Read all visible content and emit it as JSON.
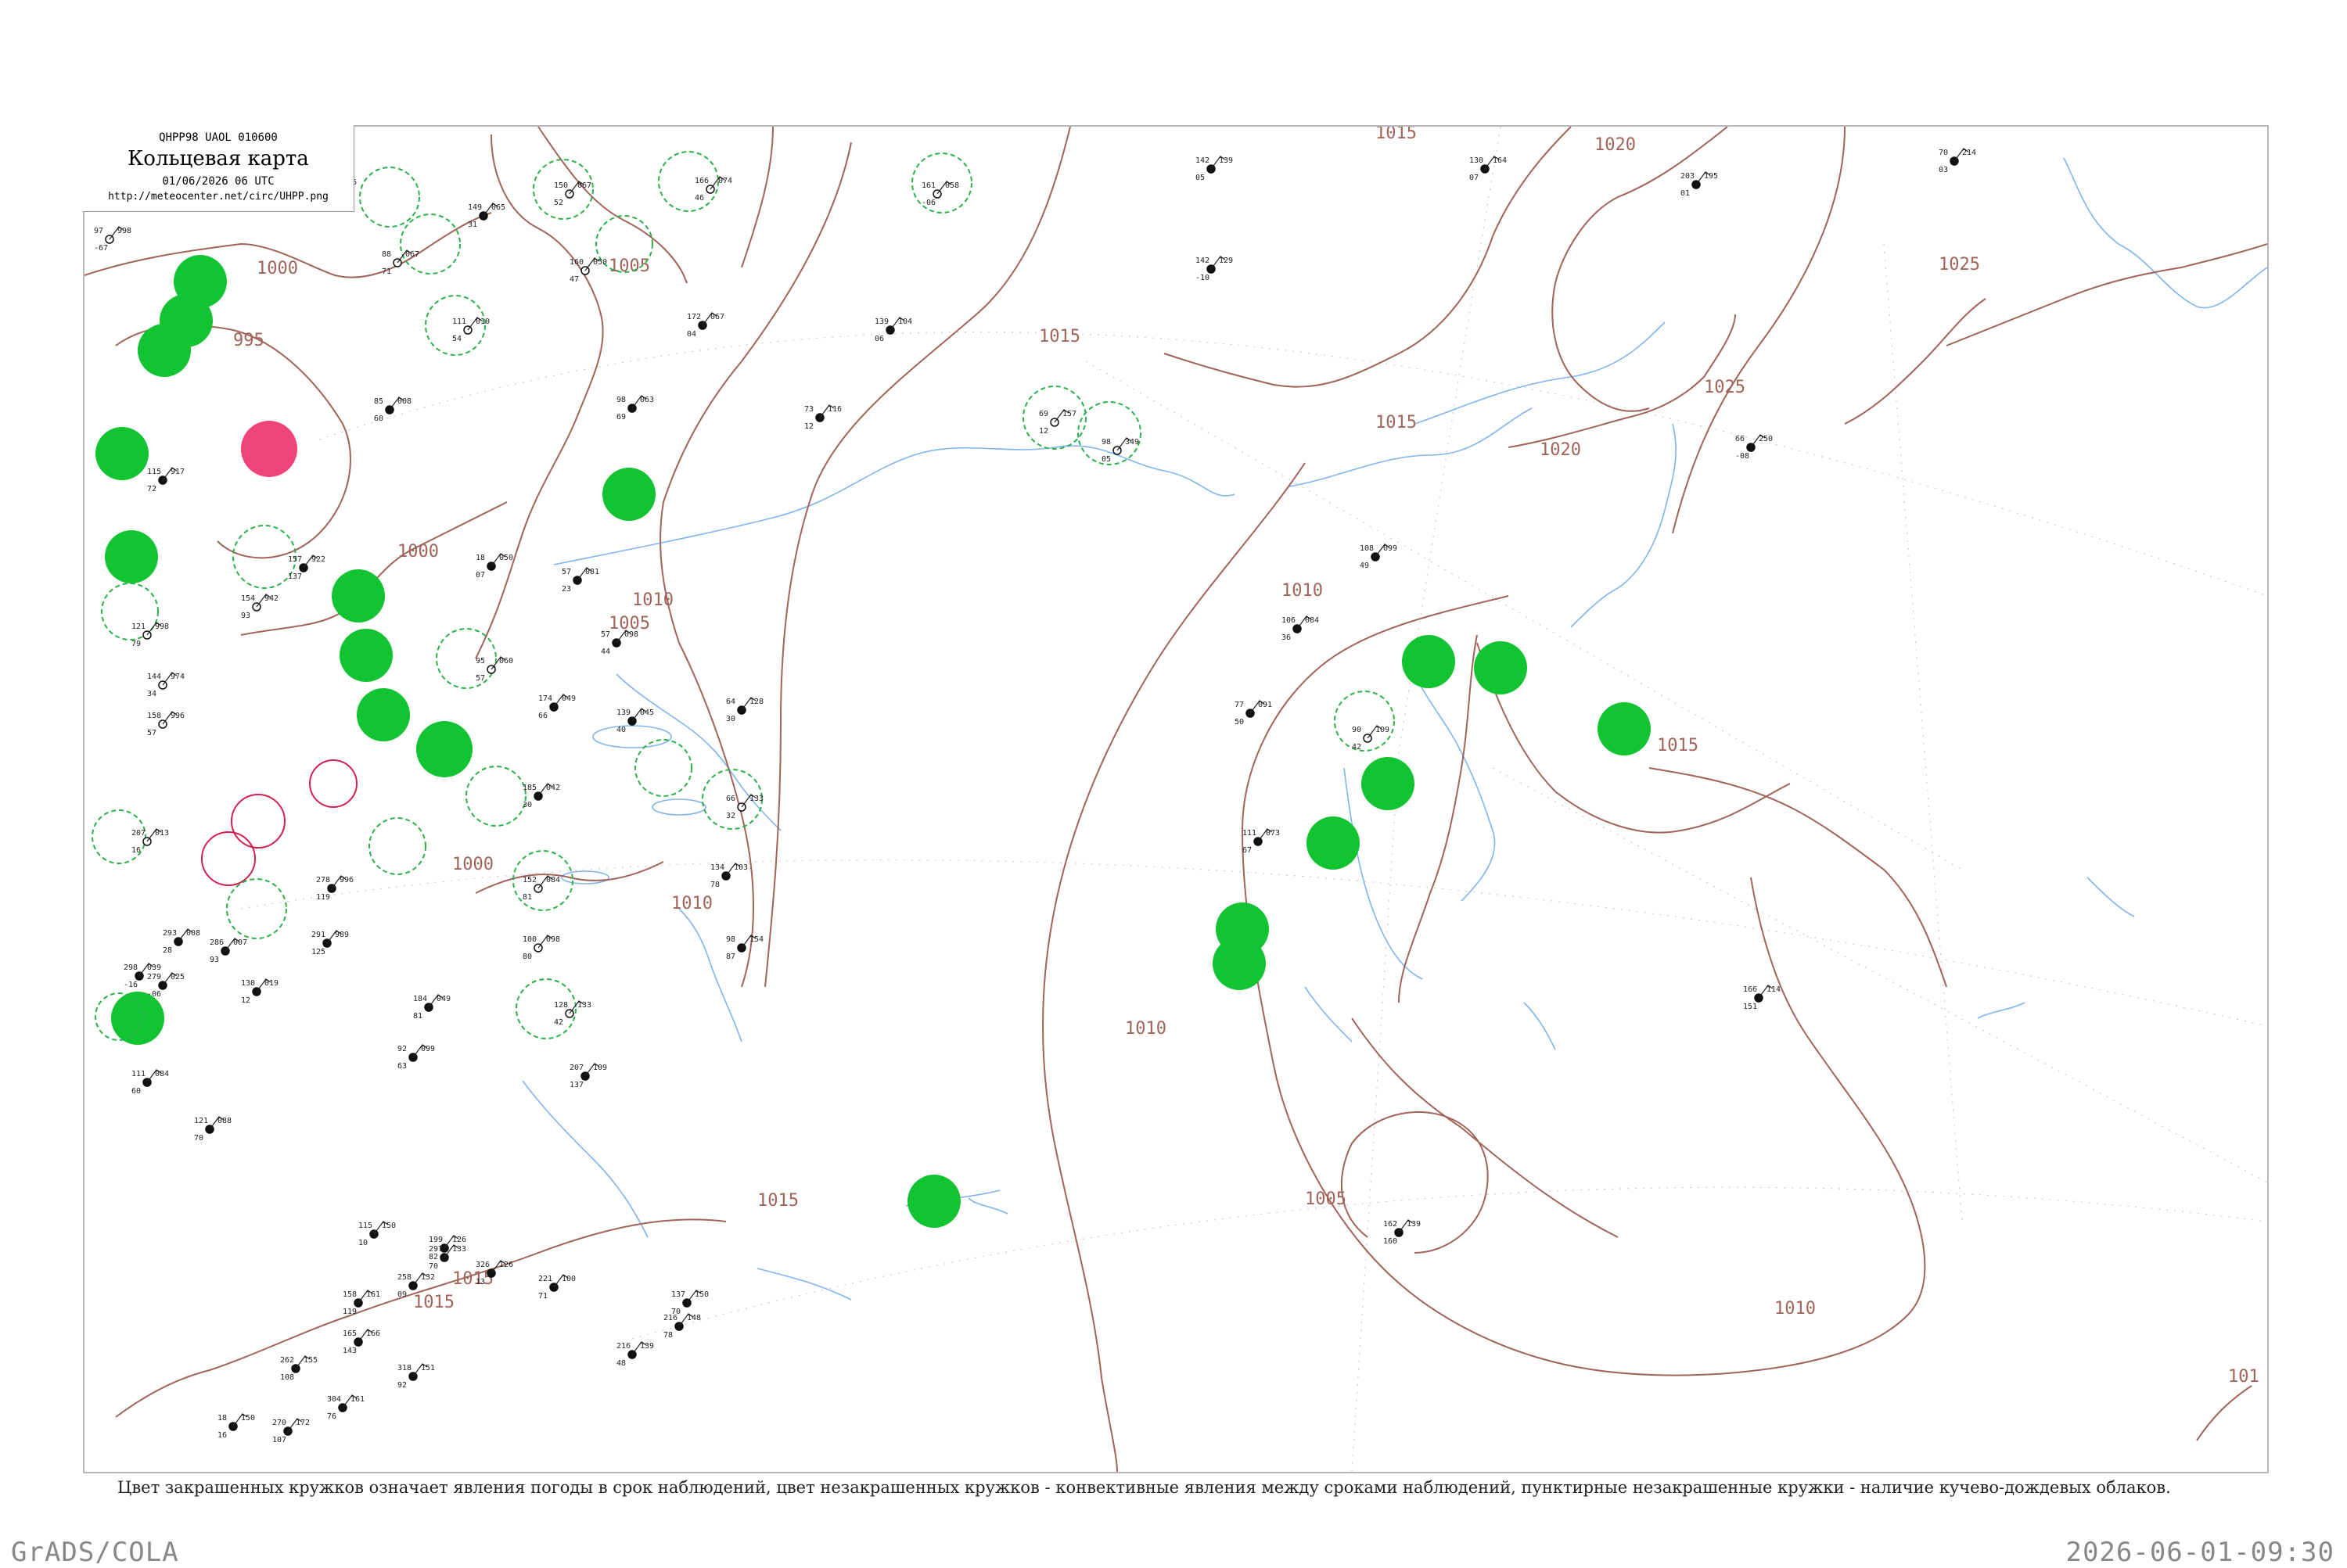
{
  "header": {
    "code": "QHPP98  UAOL  010600",
    "title": "Кольцевая карта",
    "datetime": "01/06/2026 06 UTC",
    "url": "http://meteocenter.net/circ/UHPP.png"
  },
  "legend_note": "Цвет закрашенных кружков означает явления погоды в срок наблюдений, цвет незакрашенных кружков - конвективные явления между сроками наблюдений, пунктирные незакрашенные кружки - наличие кучево-дождевых облаков.",
  "footer": {
    "left": "GrADS/COLA",
    "right": "2026-06-01-09:30"
  },
  "colors": {
    "isobar": "#a0645a",
    "river": "#6aa8e8",
    "fill_green": "#12c332",
    "fill_red": "#ee4477",
    "ring_green": "#2bb24a",
    "ring_red": "#d02050"
  },
  "isobars": [
    {
      "label": "1000",
      "id": "iso-1000-a"
    },
    {
      "label": "995",
      "id": "iso-995"
    },
    {
      "label": "1000",
      "id": "iso-1000-b"
    },
    {
      "label": "1005",
      "id": "iso-1005-a"
    },
    {
      "label": "1005",
      "id": "iso-1005-b"
    },
    {
      "label": "1000",
      "id": "iso-1000-c"
    },
    {
      "label": "1010",
      "id": "iso-1010-a"
    },
    {
      "label": "1010",
      "id": "iso-1010-b"
    },
    {
      "label": "1015",
      "id": "iso-1015-a"
    },
    {
      "label": "1015",
      "id": "iso-1015-b"
    },
    {
      "label": "1015",
      "id": "iso-1015-c"
    },
    {
      "label": "1015",
      "id": "iso-1015-d"
    },
    {
      "label": "1020",
      "id": "iso-1020-a"
    },
    {
      "label": "1020",
      "id": "iso-1020-b"
    },
    {
      "label": "1025",
      "id": "iso-1025-a"
    },
    {
      "label": "1025",
      "id": "iso-1025-b"
    },
    {
      "label": "1010",
      "id": "iso-1010-c"
    },
    {
      "label": "1010",
      "id": "iso-1010-d"
    },
    {
      "label": "1010",
      "id": "iso-1010-e"
    },
    {
      "label": "1005",
      "id": "iso-1005-c"
    },
    {
      "label": "1015",
      "id": "iso-1015-e"
    },
    {
      "label": "1015",
      "id": "iso-1015-f"
    },
    {
      "label": "101",
      "id": "iso-101"
    },
    {
      "label": "1015",
      "id": "iso-1015-g"
    }
  ],
  "stations": [
    {
      "p": "998",
      "t": "97",
      "d": "-67",
      "w": "circle"
    },
    {
      "p": "056",
      "t": "135",
      "d": "97",
      "w": "none"
    },
    {
      "p": "067",
      "t": "88",
      "d": "71",
      "w": "ring"
    },
    {
      "p": "067",
      "t": "150",
      "d": "52",
      "w": "ring"
    },
    {
      "p": "074",
      "t": "166",
      "d": "46",
      "w": "ring"
    },
    {
      "p": "058",
      "t": "161",
      "d": "-06",
      "w": "ring"
    },
    {
      "p": "139",
      "t": "142",
      "d": "05",
      "w": "none"
    },
    {
      "p": "164",
      "t": "130",
      "d": "07",
      "w": "none"
    },
    {
      "p": "214",
      "t": "70",
      "d": "03",
      "w": "none"
    },
    {
      "p": "195",
      "t": "203",
      "d": "01",
      "w": "none"
    },
    {
      "p": "129",
      "t": "142",
      "d": "-10",
      "w": "none"
    },
    {
      "p": "067",
      "t": "172",
      "d": "04",
      "w": "none"
    },
    {
      "p": "104",
      "t": "139",
      "d": "06",
      "w": "none"
    },
    {
      "p": "116",
      "t": "73",
      "d": "12",
      "w": "none"
    },
    {
      "p": "157",
      "t": "69",
      "d": "12",
      "w": "ring"
    },
    {
      "p": "349",
      "t": "98",
      "d": "05",
      "w": "ring"
    },
    {
      "p": "250",
      "t": "66",
      "d": "-08",
      "w": "none"
    },
    {
      "p": "099",
      "t": "108",
      "d": "49",
      "w": "none"
    },
    {
      "p": "084",
      "t": "106",
      "d": "36",
      "w": "none"
    },
    {
      "p": "091",
      "t": "77",
      "d": "50",
      "w": "none"
    },
    {
      "p": "109",
      "t": "90",
      "d": "42",
      "w": "ring"
    },
    {
      "p": "073",
      "t": "111",
      "d": "67",
      "w": "none"
    },
    {
      "p": "114",
      "t": "166",
      "d": "151",
      "w": "none"
    },
    {
      "p": "139",
      "t": "162",
      "d": "160",
      "w": "none"
    },
    {
      "p": "081",
      "t": "57",
      "d": "23",
      "w": "none"
    },
    {
      "p": "098",
      "t": "57",
      "d": "44",
      "w": "none"
    },
    {
      "p": "063",
      "t": "98",
      "d": "69",
      "w": "none"
    },
    {
      "p": "008",
      "t": "85",
      "d": "60",
      "w": "none"
    },
    {
      "p": "010",
      "t": "111",
      "d": "54",
      "w": "ring"
    },
    {
      "p": "065",
      "t": "149",
      "d": "31",
      "w": "none"
    },
    {
      "p": "050",
      "t": "160",
      "d": "47",
      "w": "ring"
    },
    {
      "p": "050",
      "t": "18",
      "d": "07",
      "w": "none"
    },
    {
      "p": "049",
      "t": "174",
      "d": "66",
      "w": "none"
    },
    {
      "p": "045",
      "t": "139",
      "d": "40",
      "w": "none"
    },
    {
      "p": "128",
      "t": "64",
      "d": "30",
      "w": "none"
    },
    {
      "p": "060",
      "t": "95",
      "d": "57",
      "w": "ring"
    },
    {
      "p": "042",
      "t": "185",
      "d": "30",
      "w": "none"
    },
    {
      "p": "133",
      "t": "66",
      "d": "32",
      "w": "ring"
    },
    {
      "p": "103",
      "t": "134",
      "d": "78",
      "w": "none"
    },
    {
      "p": "154",
      "t": "98",
      "d": "87",
      "w": "none"
    },
    {
      "p": "084",
      "t": "152",
      "d": "81",
      "w": "ring"
    },
    {
      "p": "098",
      "t": "100",
      "d": "80",
      "w": "ring"
    },
    {
      "p": "133",
      "t": "128",
      "d": "42",
      "w": "ring"
    },
    {
      "p": "109",
      "t": "207",
      "d": "137",
      "w": "none"
    },
    {
      "p": "049",
      "t": "184",
      "d": "81",
      "w": "none"
    },
    {
      "p": "099",
      "t": "92",
      "d": "63",
      "w": "none"
    },
    {
      "p": "084",
      "t": "111",
      "d": "60",
      "w": "none"
    },
    {
      "p": "088",
      "t": "121",
      "d": "70",
      "w": "none"
    },
    {
      "p": "008",
      "t": "293",
      "d": "28",
      "w": "none"
    },
    {
      "p": "039",
      "t": "298",
      "d": "-16",
      "w": "none"
    },
    {
      "p": "989",
      "t": "291",
      "d": "125",
      "w": "none"
    },
    {
      "p": "996",
      "t": "278",
      "d": "119",
      "w": "none"
    },
    {
      "p": "942",
      "t": "154",
      "d": "93",
      "w": "ring"
    },
    {
      "p": "922",
      "t": "157",
      "d": "137",
      "w": "none"
    },
    {
      "p": "917",
      "t": "115",
      "d": "72",
      "w": "none"
    },
    {
      "p": "998",
      "t": "121",
      "d": "79",
      "w": "ring"
    },
    {
      "p": "974",
      "t": "144",
      "d": "34",
      "w": "ring"
    },
    {
      "p": "996",
      "t": "158",
      "d": "57",
      "w": "ring"
    },
    {
      "p": "013",
      "t": "207",
      "d": "16",
      "w": "ring"
    },
    {
      "p": "025",
      "t": "279",
      "d": "-06",
      "w": "none"
    },
    {
      "p": "007",
      "t": "286",
      "d": "93",
      "w": "none"
    },
    {
      "p": "019",
      "t": "130",
      "d": "12",
      "w": "none"
    },
    {
      "p": "150",
      "t": "115",
      "d": "10",
      "w": "none"
    },
    {
      "p": "126",
      "t": "199",
      "d": "82",
      "w": "none"
    },
    {
      "p": "133",
      "t": "297",
      "d": "70",
      "w": "none"
    },
    {
      "p": "126",
      "t": "326",
      "d": "13",
      "w": "none"
    },
    {
      "p": "100",
      "t": "221",
      "d": "71",
      "w": "none"
    },
    {
      "p": "150",
      "t": "137",
      "d": "70",
      "w": "none"
    },
    {
      "p": "148",
      "t": "216",
      "d": "78",
      "w": "none"
    },
    {
      "p": "139",
      "t": "216",
      "d": "48",
      "w": "none"
    },
    {
      "p": "132",
      "t": "258",
      "d": "09",
      "w": "none"
    },
    {
      "p": "161",
      "t": "158",
      "d": "119",
      "w": "none"
    },
    {
      "p": "166",
      "t": "165",
      "d": "143",
      "w": "none"
    },
    {
      "p": "155",
      "t": "262",
      "d": "108",
      "w": "none"
    },
    {
      "p": "161",
      "t": "304",
      "d": "76",
      "w": "none"
    },
    {
      "p": "151",
      "t": "318",
      "d": "92",
      "w": "none"
    },
    {
      "p": "172",
      "t": "270",
      "d": "107",
      "w": "none"
    },
    {
      "p": "150",
      "t": "18",
      "d": "16",
      "w": "none"
    }
  ],
  "weather_markers": [
    {
      "id": "wx-1",
      "fill": "green"
    },
    {
      "id": "wx-2",
      "fill": "green"
    },
    {
      "id": "wx-3",
      "fill": "green"
    },
    {
      "id": "wx-4",
      "fill": "green"
    },
    {
      "id": "wx-5",
      "fill": "green"
    },
    {
      "id": "wx-6",
      "fill": "red"
    },
    {
      "id": "wx-7",
      "fill": "green"
    },
    {
      "id": "wx-8",
      "fill": "green"
    },
    {
      "id": "wx-9",
      "fill": "green"
    },
    {
      "id": "wx-10",
      "fill": "green"
    },
    {
      "id": "wx-11",
      "fill": "green"
    },
    {
      "id": "wx-12",
      "fill": "green"
    },
    {
      "id": "wx-13",
      "fill": "green"
    },
    {
      "id": "wx-14",
      "fill": "green"
    },
    {
      "id": "wx-15",
      "fill": "green"
    },
    {
      "id": "wx-16",
      "fill": "green"
    },
    {
      "id": "wx-17",
      "fill": "green"
    },
    {
      "id": "wx-18",
      "fill": "green"
    },
    {
      "id": "wx-19",
      "fill": "green"
    },
    {
      "id": "wx-20",
      "fill": "green"
    },
    {
      "id": "wx-21",
      "fill": "green"
    },
    {
      "id": "wx-22",
      "fill": "green"
    },
    {
      "id": "wx-23",
      "fill": "green"
    },
    {
      "id": "wx-24",
      "fill": "green"
    }
  ]
}
